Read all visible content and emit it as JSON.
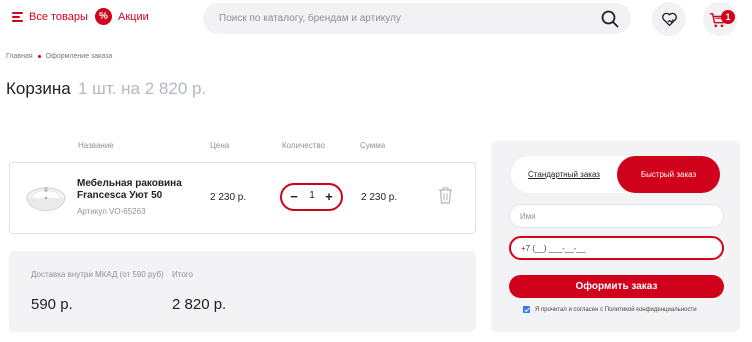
{
  "header": {
    "all_goods": "Все товары",
    "sale_icon": "%",
    "sale": "Акции",
    "search_placeholder": "Поиск по каталогу, брендам и артикулу",
    "cart_count": "1"
  },
  "breadcrumb": {
    "home": "Главная",
    "current": "Оформление заказа"
  },
  "page": {
    "title": "Корзина",
    "subtitle": "1 шт. на 2 820 р."
  },
  "table": {
    "headers": [
      "Название",
      "Цена",
      "Количество",
      "Сумма"
    ],
    "item": {
      "name": "Мебельная раковина Francesca Уют 50",
      "sku": "Артикул VO-65263",
      "price": "2 230 р.",
      "qty_minus": "−",
      "quantity": "1",
      "qty_plus": "+",
      "sum": "2 230 р."
    }
  },
  "summary": {
    "delivery_label": "Доставка внутри МКАД (от 590 руб)",
    "delivery_value": "590 р.",
    "total_label": "Итого",
    "total_value": "2 820 р."
  },
  "order": {
    "tab_standard": "Стандартный заказ",
    "tab_fast": "Быстрый заказ",
    "name_placeholder": "Имя",
    "phone_value": "+7 (__) ___-__-__",
    "submit": "Оформить заказ",
    "agree_text": "Я прочитал и согласен с Политикой конфиденциальности"
  },
  "colors": {
    "accent": "#d0021b",
    "muted": "#8d929c",
    "panel": "#f3f3f5",
    "checkbox": "#3479f6"
  },
  "icons": [
    "menu-icon",
    "percent-icon",
    "search-icon",
    "favorites-heart-icon",
    "cart-icon",
    "trash-icon",
    "check-icon"
  ]
}
